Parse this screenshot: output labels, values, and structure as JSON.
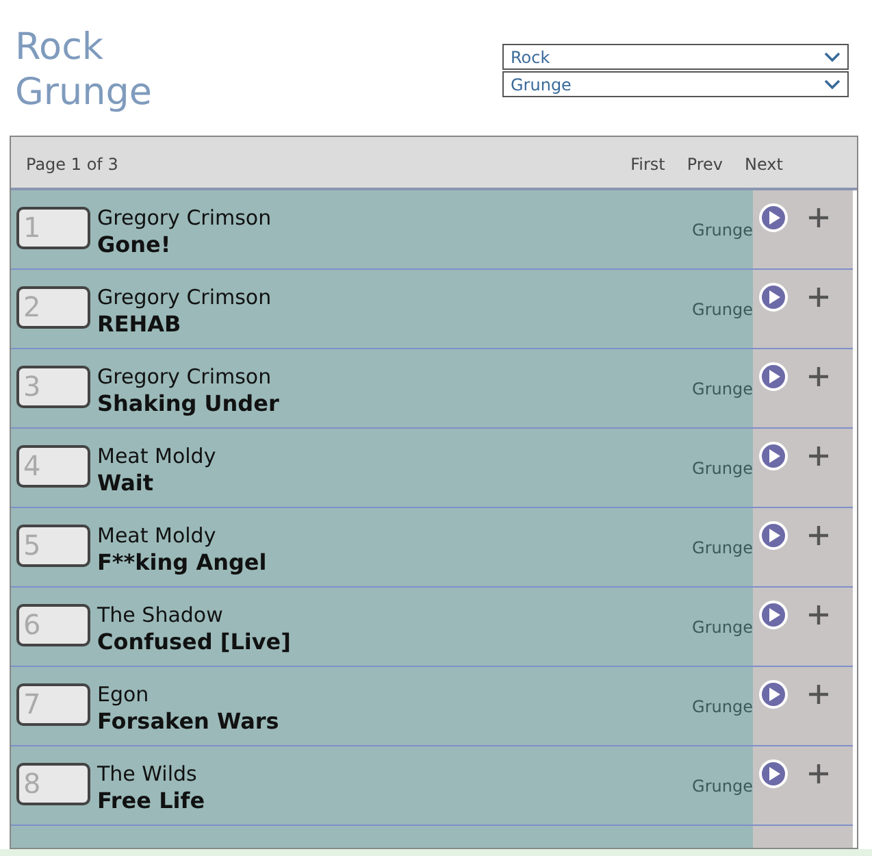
{
  "title": {
    "lines": [
      "Rock",
      "Grunge"
    ]
  },
  "selects": [
    {
      "value": "Rock"
    },
    {
      "value": "Grunge"
    }
  ],
  "pager": {
    "status": "Page 1 of 3",
    "links": [
      "First",
      "Prev",
      "Next"
    ]
  },
  "tracks": [
    {
      "number": "1",
      "artist": "Gregory Crimson",
      "song": "Gone!",
      "genre": "Grunge"
    },
    {
      "number": "2",
      "artist": "Gregory Crimson",
      "song": "REHAB",
      "genre": "Grunge"
    },
    {
      "number": "3",
      "artist": "Gregory Crimson",
      "song": "Shaking Under",
      "genre": "Grunge"
    },
    {
      "number": "4",
      "artist": "Meat Moldy",
      "song": "Wait",
      "genre": "Grunge"
    },
    {
      "number": "5",
      "artist": "Meat Moldy",
      "song": "F**king Angel",
      "genre": "Grunge"
    },
    {
      "number": "6",
      "artist": "The Shadow",
      "song": "Confused [Live]",
      "genre": "Grunge"
    },
    {
      "number": "7",
      "artist": "Egon",
      "song": "Forsaken Wars",
      "genre": "Grunge"
    },
    {
      "number": "8",
      "artist": "The Wilds",
      "song": "Free Life",
      "genre": "Grunge"
    }
  ]
}
